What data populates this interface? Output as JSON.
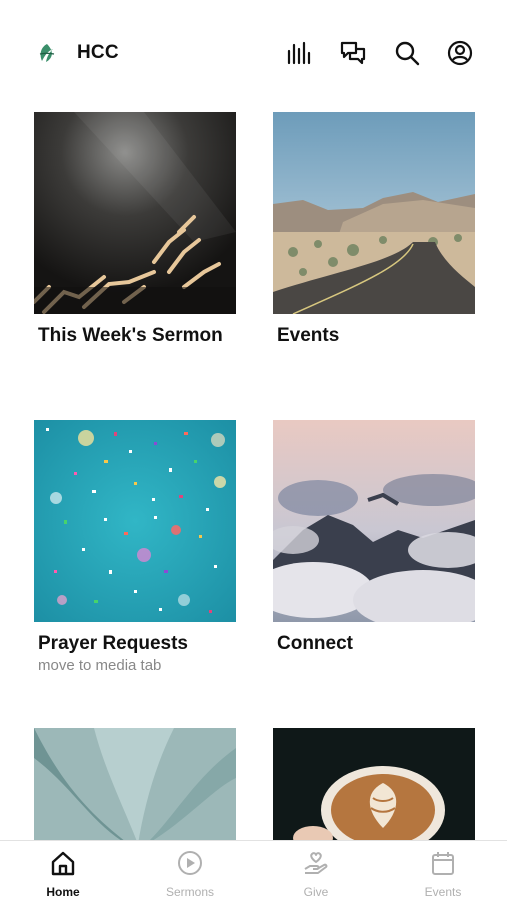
{
  "header": {
    "title": "HCC",
    "logo_icon": "hcc-leaf-logo",
    "actions": [
      {
        "icon": "audio-bars-icon"
      },
      {
        "icon": "chat-bubbles-icon"
      },
      {
        "icon": "search-icon"
      },
      {
        "icon": "user-icon"
      }
    ]
  },
  "cards": [
    {
      "title": "This Week's Sermon",
      "subtitle": "",
      "image": "raised-hands-in-light"
    },
    {
      "title": "Events",
      "subtitle": "",
      "image": "desert-road"
    },
    {
      "title": "Prayer Requests",
      "subtitle": "move to media tab",
      "image": "confetti-on-teal"
    },
    {
      "title": "Connect",
      "subtitle": "",
      "image": "mountains-above-clouds"
    },
    {
      "title": "",
      "subtitle": "",
      "image": "succulent-plant"
    },
    {
      "title": "",
      "subtitle": "",
      "image": "latte-art-cup"
    }
  ],
  "tabbar": {
    "tabs": [
      {
        "label": "Home",
        "icon": "home-icon",
        "active": true
      },
      {
        "label": "Sermons",
        "icon": "play-circle-icon",
        "active": false
      },
      {
        "label": "Give",
        "icon": "hand-heart-icon",
        "active": false
      },
      {
        "label": "Events",
        "icon": "calendar-icon",
        "active": false
      }
    ]
  },
  "colors": {
    "active_tab": "#111111",
    "inactive_tab": "#b0b0b0",
    "subtitle": "#888888",
    "logo_green": "#3a8f6a"
  }
}
